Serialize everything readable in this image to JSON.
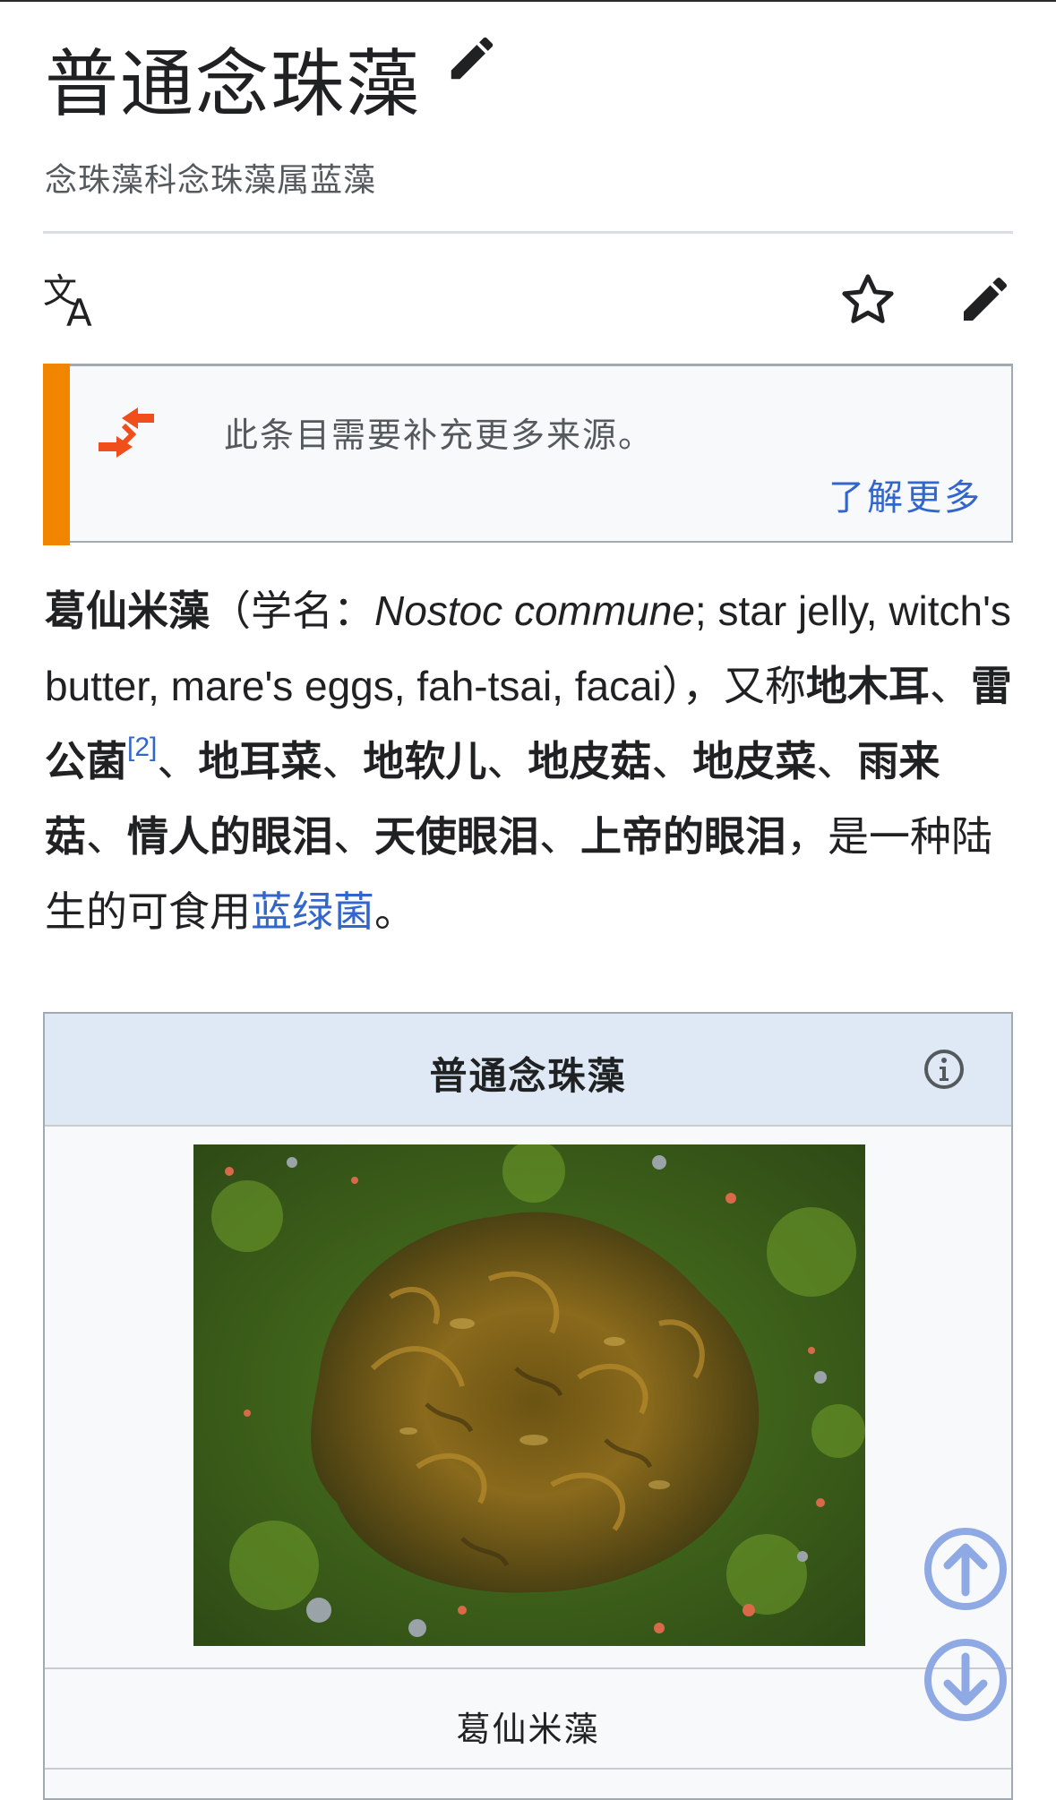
{
  "page": {
    "title": "普通念珠藻",
    "subtitle": "念珠藻科念珠藻属蓝藻"
  },
  "toolbar": {
    "icons": [
      "language-icon",
      "star-icon",
      "edit-icon"
    ]
  },
  "notice": {
    "text": "此条目需要补充更多来源。",
    "link": "了解更多",
    "accent_color": "#f28500"
  },
  "lead": {
    "name_bold": "葛仙米藻",
    "open_paren": "（学名：",
    "scientific_name": "Nostoc commune",
    "english_names": "; star jelly, witch's butter, mare's eggs, fah-tsai, facai）",
    "comma": "，",
    "also_called": "又称",
    "alias_1": "地木耳",
    "sep_1": "、",
    "alias_2": "雷公菌",
    "citation": "[2]",
    "sep_2": "、",
    "alias_3": "地耳菜",
    "sep_3": "、",
    "alias_4": "地软儿",
    "sep_4": "、",
    "alias_5": "地皮菇",
    "sep_5": "、",
    "alias_6": "地皮菜",
    "sep_6": "、",
    "alias_7": "雨来菇",
    "sep_7": "、",
    "alias_8": "情人的眼泪",
    "sep_8": "、",
    "alias_9": "天使眼泪",
    "sep_9": "、",
    "alias_10": "上帝的眼泪",
    "desc_start": "，是一种陆生的可食用",
    "link_cyanobacteria": "蓝绿菌",
    "period": "。",
    "link_color": "#3366cc"
  },
  "infobox": {
    "title": "普通念珠藻",
    "caption": "葛仙米藻",
    "header_color": "#dee9f5",
    "image": "Nostoc commune colony on moss"
  },
  "scroll": {
    "up": "arrow-up-circle-icon",
    "down": "arrow-down-circle-icon",
    "color": "#8fa9e4"
  }
}
